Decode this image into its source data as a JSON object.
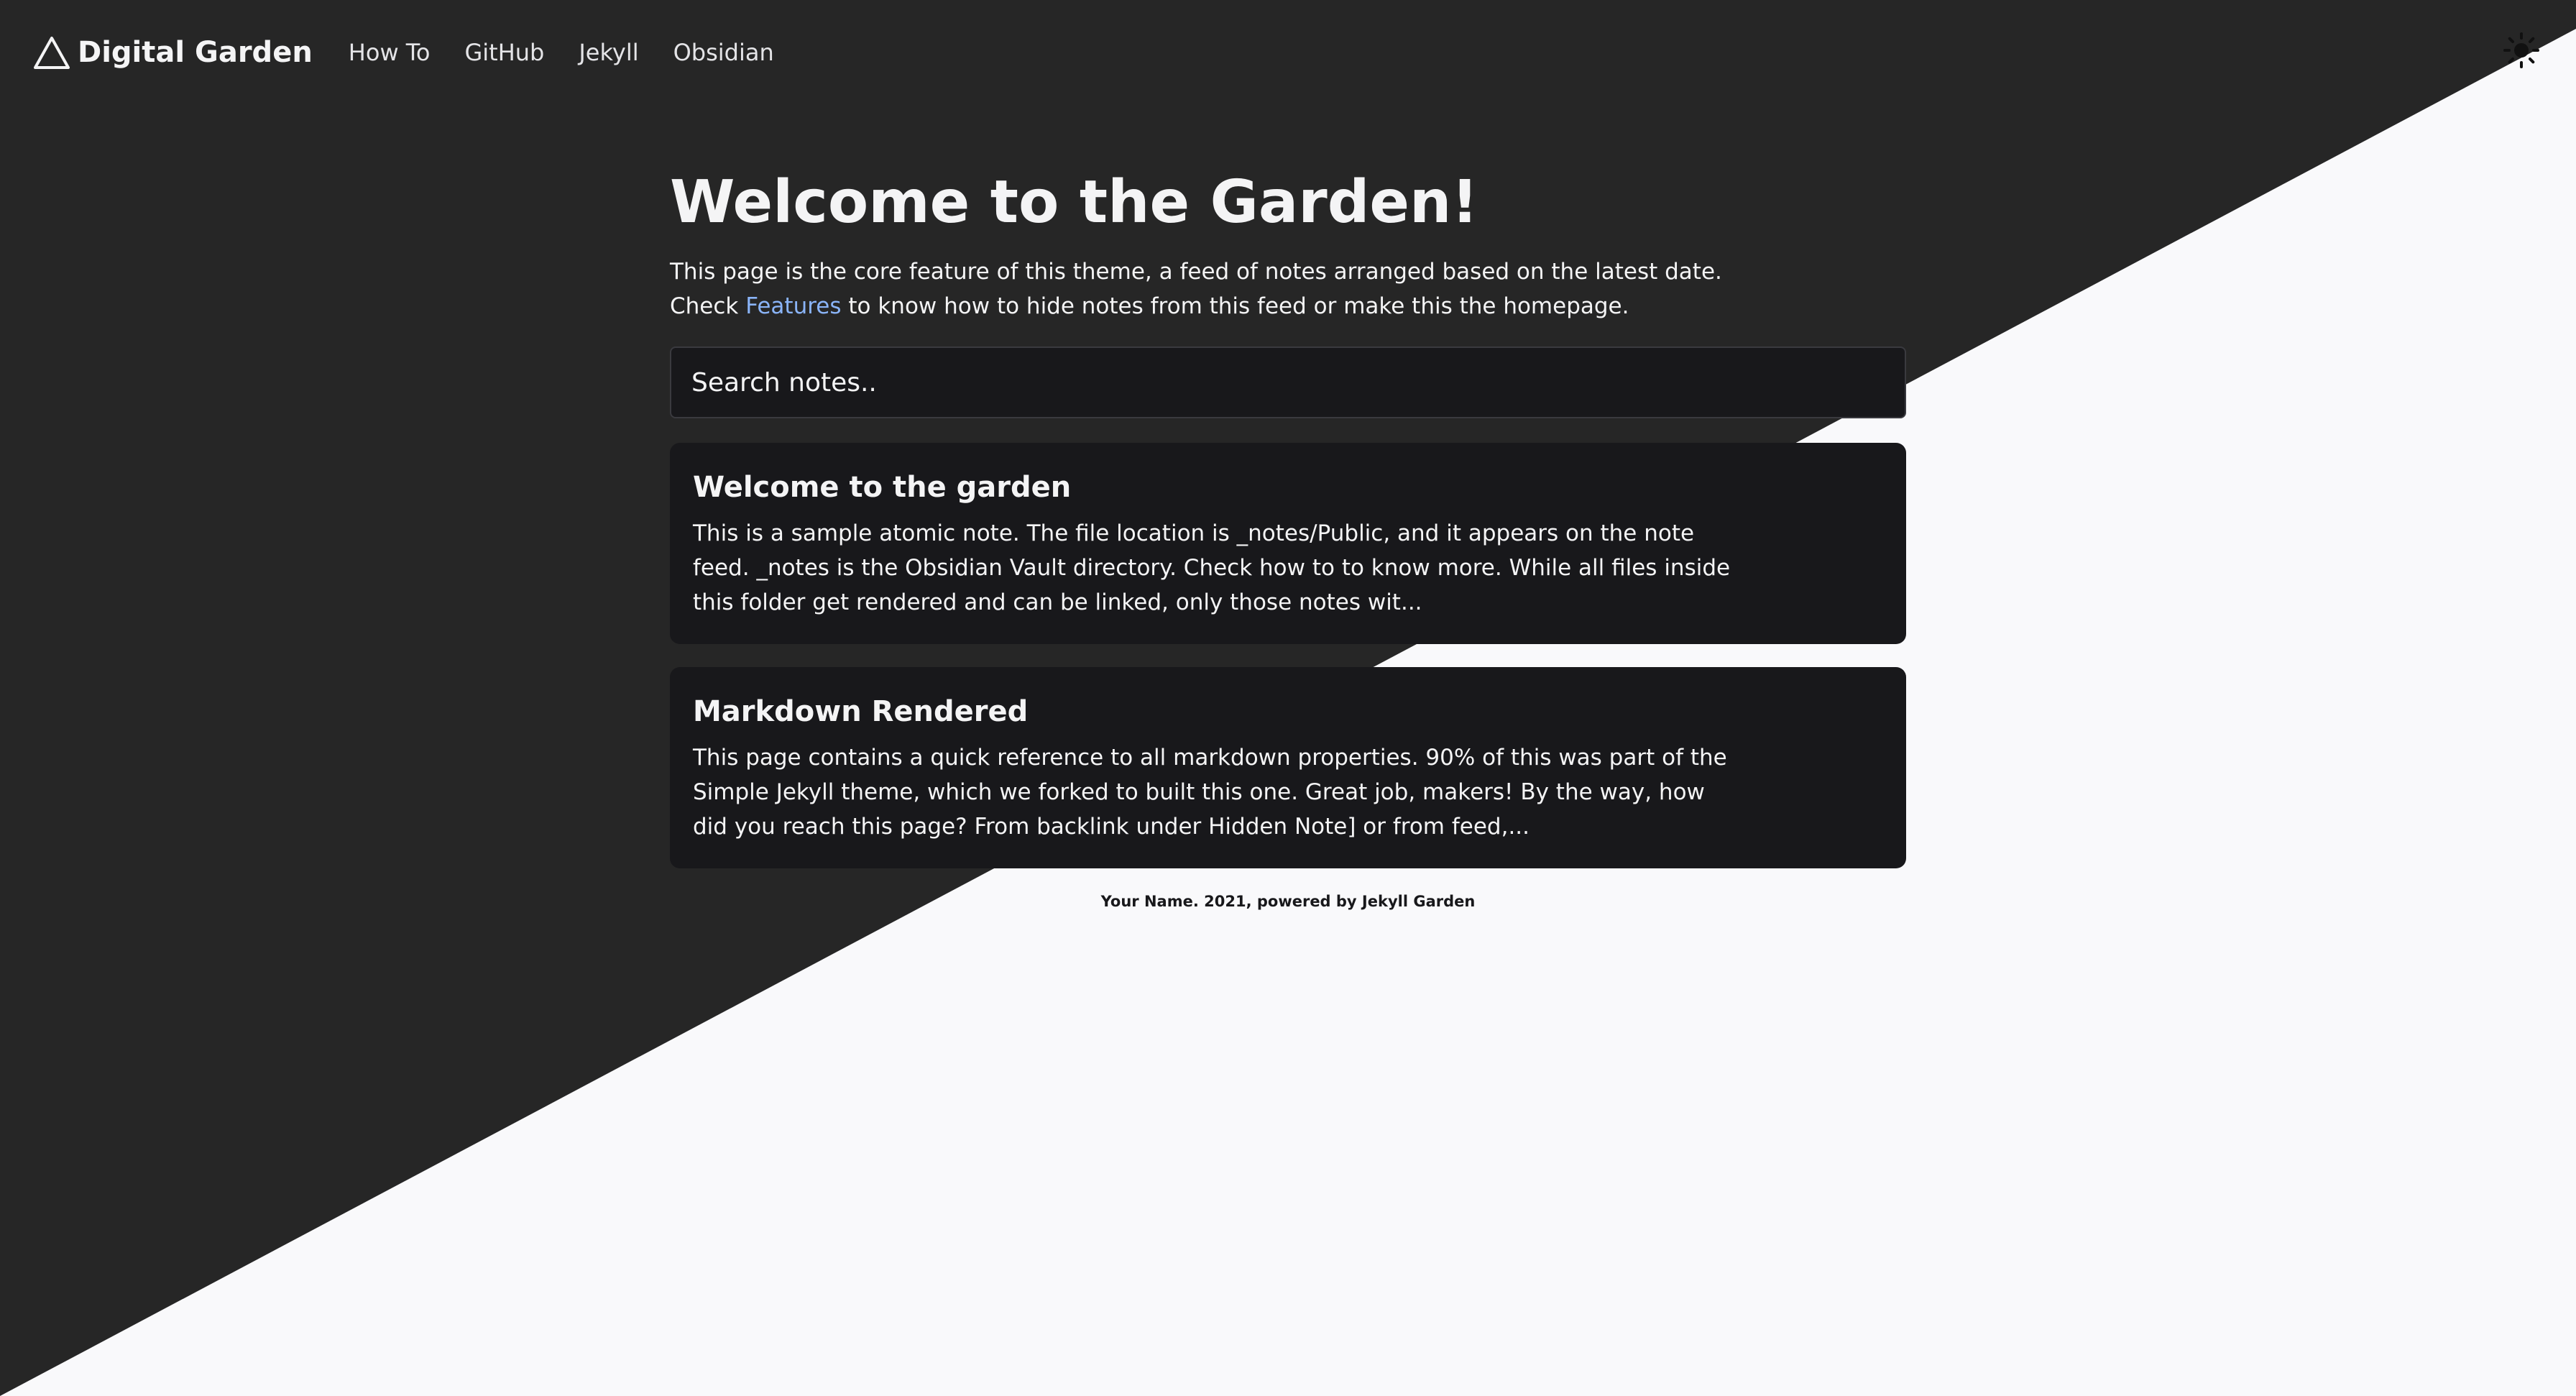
{
  "nav": {
    "brand": "Digital Garden",
    "links": [
      "How To",
      "GitHub",
      "Jekyll",
      "Obsidian"
    ]
  },
  "main": {
    "title": "Welcome to the Garden!",
    "intro_line1": "This page is the core feature of this theme, a feed of notes arranged based on the latest date.",
    "intro_line2_before": "Check ",
    "intro_link": "Features",
    "intro_line2_after": " to know how to hide notes from this feed or make this the homepage.",
    "search_placeholder": "Search notes..",
    "notes": [
      {
        "title": "Welcome to the garden",
        "excerpt": "This is a sample atomic note. The file location is _notes/Public, and it appears on the note feed. _notes is the Obsidian Vault directory. Check how to to know more. While all files inside this folder get rendered and can be linked, only those notes wit..."
      },
      {
        "title": "Markdown Rendered",
        "excerpt": "This page contains a quick reference to all markdown properties. 90% of this was part of the Simple Jekyll theme, which we forked to built this one. Great job, makers! By the way, how did you reach this page? From backlink under Hidden Note] or from feed,..."
      }
    ]
  },
  "footer": {
    "text": "Your Name. 2021, powered by Jekyll Garden"
  },
  "colors": {
    "dark_bg": "#262626",
    "light_bg": "#f9f9fb",
    "card_dark": "#18181b",
    "link": "#8ab4f8"
  },
  "icons": {
    "logo": "triangle-icon",
    "theme_toggle": "sun-icon"
  }
}
